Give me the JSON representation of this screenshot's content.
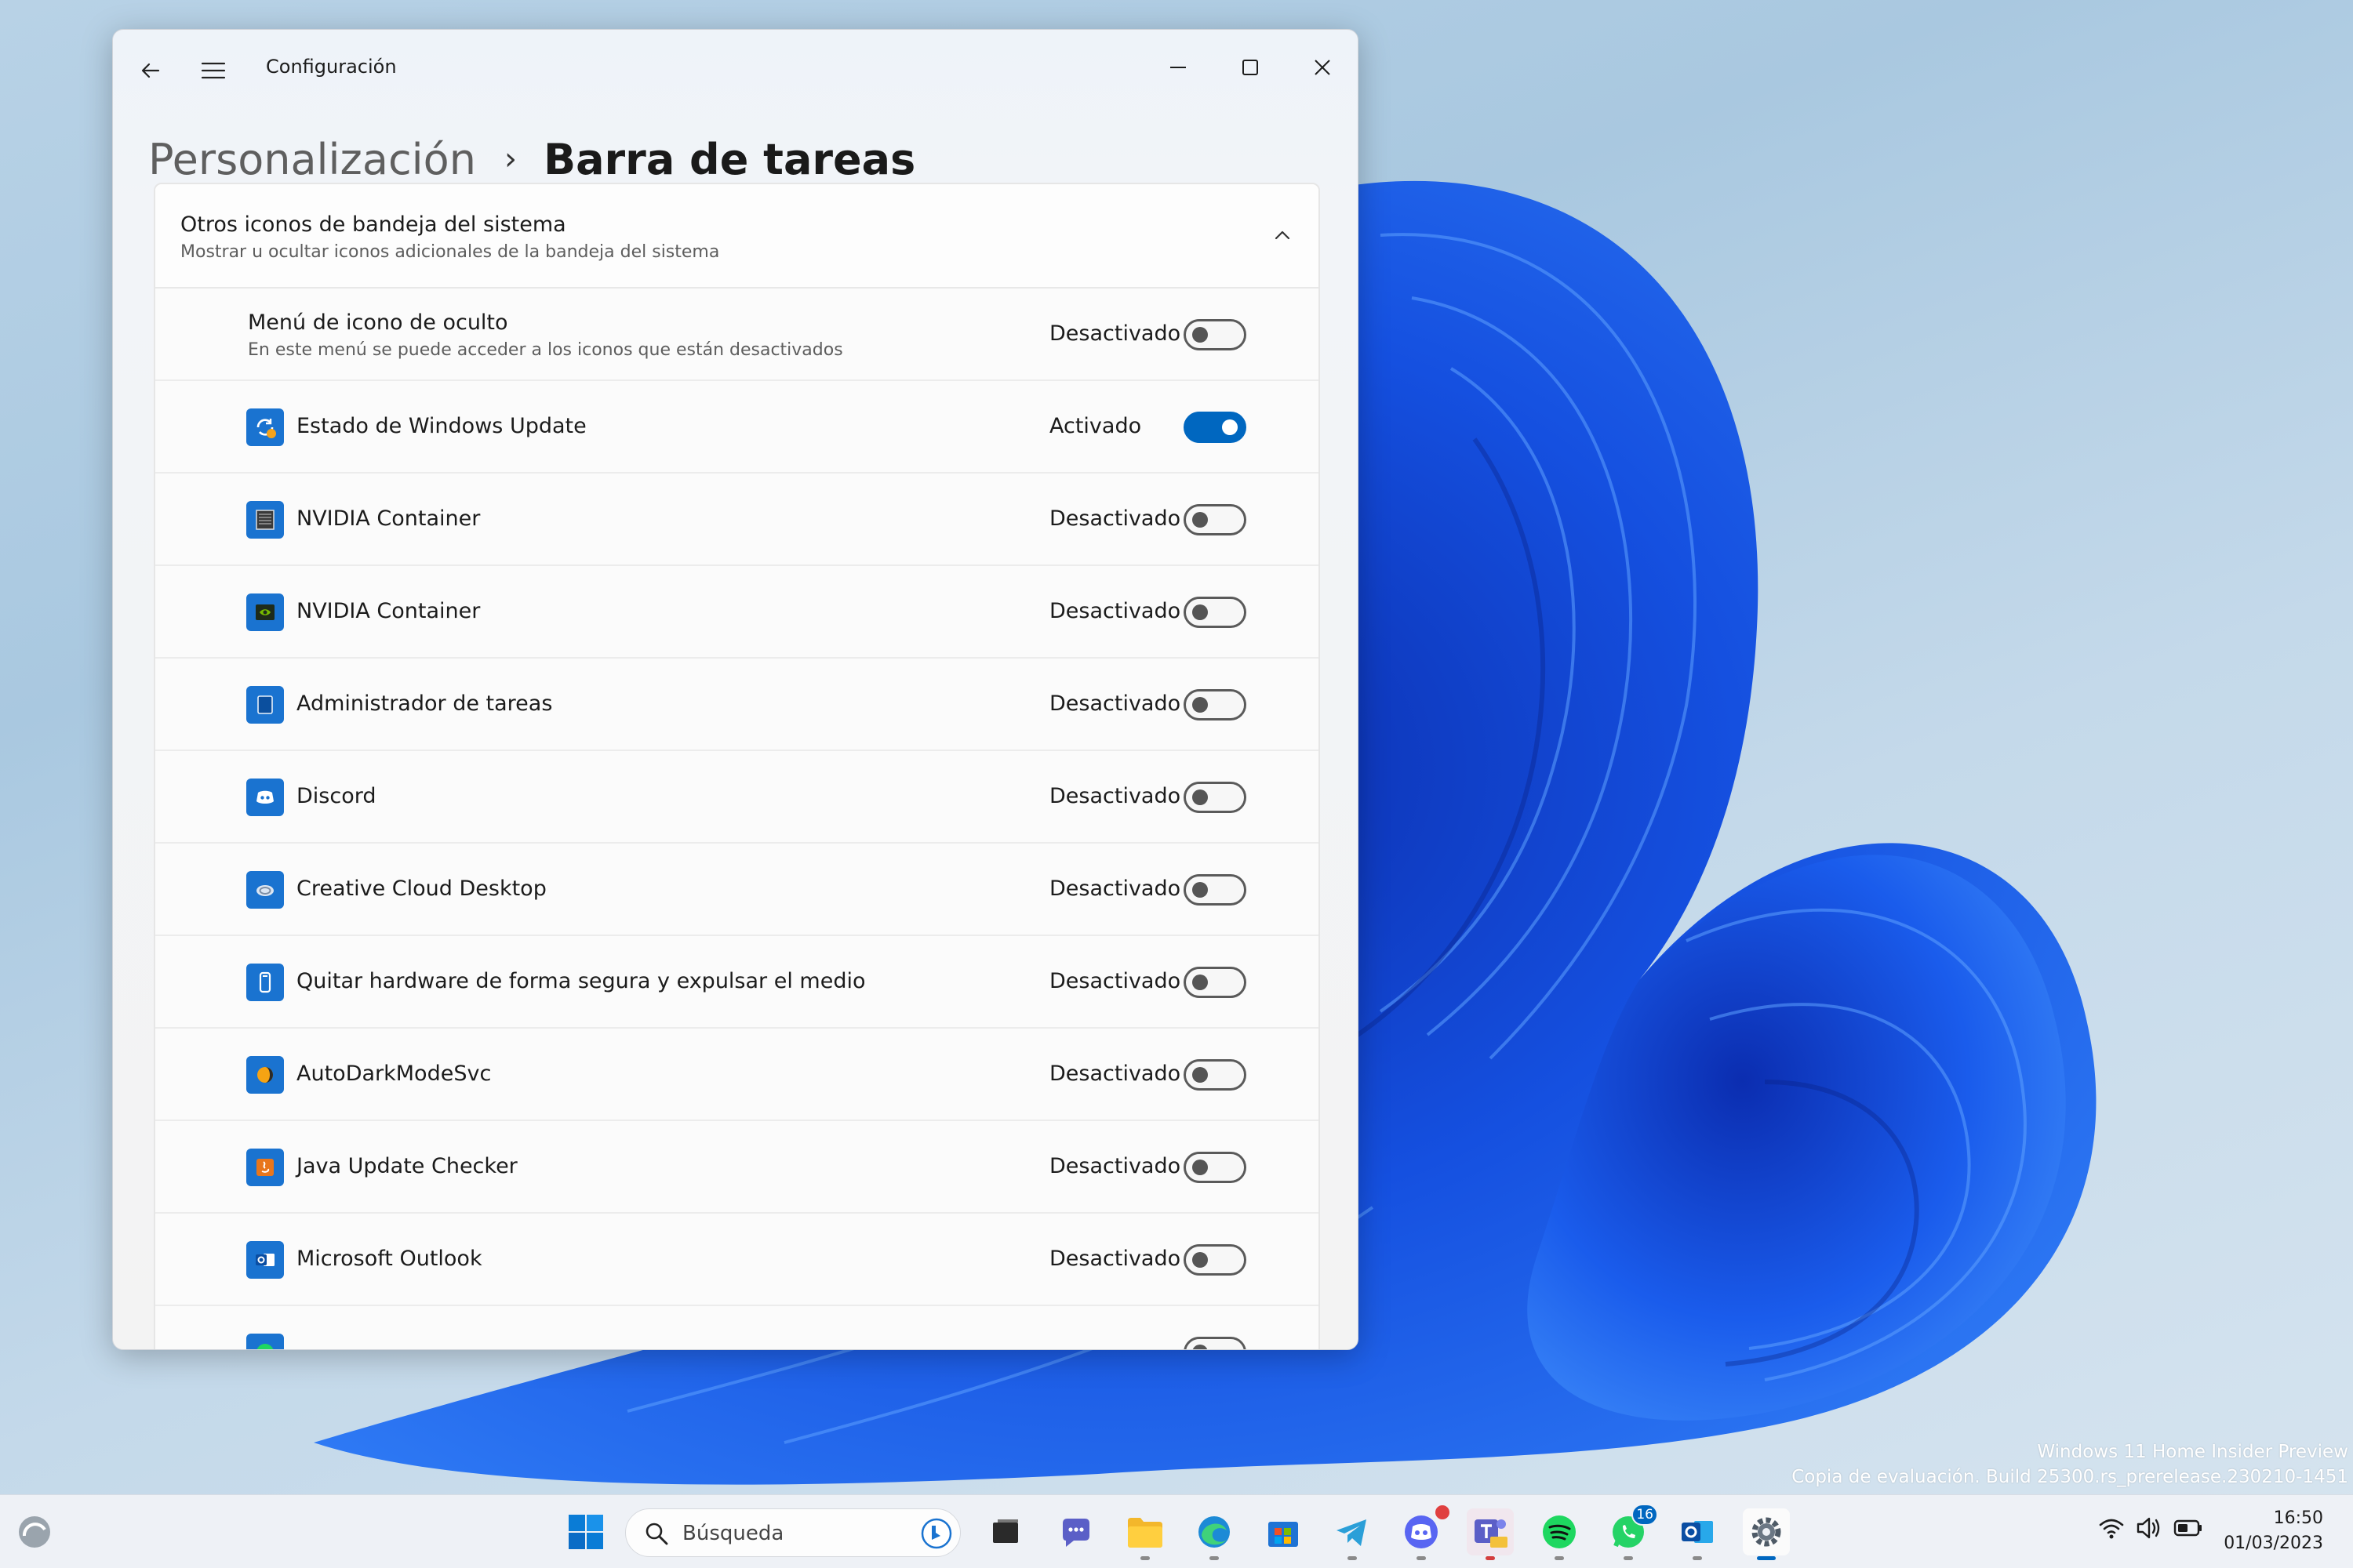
{
  "window": {
    "app_title": "Configuración",
    "breadcrumb_parent": "Personalización",
    "breadcrumb_separator": "›",
    "breadcrumb_current": "Barra de tareas"
  },
  "section": {
    "title": "Otros iconos de bandeja del sistema",
    "subtitle": "Mostrar u ocultar iconos adicionales de la bandeja del sistema",
    "hidden_menu": {
      "title": "Menú de icono de oculto",
      "subtitle": "En este menú se puede acceder a los iconos que están desactivados",
      "state": "Desactivado",
      "on": false
    },
    "items": [
      {
        "label": "Estado de Windows Update",
        "state": "Activado",
        "on": true,
        "icon": "windows-update-icon"
      },
      {
        "label": "NVIDIA Container",
        "state": "Desactivado",
        "on": false,
        "icon": "nvidia-container-icon"
      },
      {
        "label": "NVIDIA Container",
        "state": "Desactivado",
        "on": false,
        "icon": "nvidia-icon"
      },
      {
        "label": "Administrador de tareas",
        "state": "Desactivado",
        "on": false,
        "icon": "task-manager-icon"
      },
      {
        "label": "Discord",
        "state": "Desactivado",
        "on": false,
        "icon": "discord-icon"
      },
      {
        "label": "Creative Cloud Desktop",
        "state": "Desactivado",
        "on": false,
        "icon": "creative-cloud-icon"
      },
      {
        "label": "Quitar hardware de forma segura y expulsar el medio",
        "state": "Desactivado",
        "on": false,
        "icon": "usb-eject-icon"
      },
      {
        "label": "AutoDarkModeSvc",
        "state": "Desactivado",
        "on": false,
        "icon": "auto-dark-mode-icon"
      },
      {
        "label": "Java Update Checker",
        "state": "Desactivado",
        "on": false,
        "icon": "java-icon"
      },
      {
        "label": "Microsoft Outlook",
        "state": "Desactivado",
        "on": false,
        "icon": "outlook-icon"
      }
    ]
  },
  "watermark": {
    "line1": "Windows 11 Home Insider Preview",
    "line2": "Copia de evaluación. Build 25300.rs_prerelease.230210-1451"
  },
  "taskbar": {
    "search_placeholder": "Búsqueda",
    "whatsapp_badge": "16",
    "time": "16:50",
    "date": "01/03/2023"
  },
  "colors": {
    "accent": "#0067c0",
    "wallpaper_blue": "#1447d6"
  }
}
